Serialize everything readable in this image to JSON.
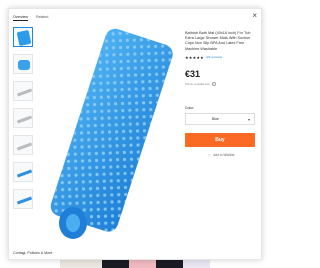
{
  "tabs": [
    {
      "label": "Overview",
      "active": true
    },
    {
      "label": "Related",
      "active": false
    }
  ],
  "product": {
    "title": "Bathtub Bath Mat (40x16 inch) For Tub Extra Large Shower Mats With Suction Cups Non Slip BPA And Latex Free Machine Washable",
    "stars": "★★★★★",
    "reviews": "(29 reviews)",
    "price": "€31",
    "points_text": "Phone versatile size"
  },
  "color": {
    "label": "Color:",
    "selected": "Blue"
  },
  "actions": {
    "buy_label": "Buy",
    "wishlist_label": "Add to Wishlist"
  },
  "footer": {
    "link": "Contact, Policies & More"
  },
  "icons": {
    "close": "close-icon",
    "chevron": "chevron-down-icon",
    "heart": "heart-icon",
    "info": "info-icon"
  },
  "colors": {
    "accent": "#fa6a24",
    "mat_blue": "#2b96e6",
    "link_blue": "#1e88e5"
  }
}
